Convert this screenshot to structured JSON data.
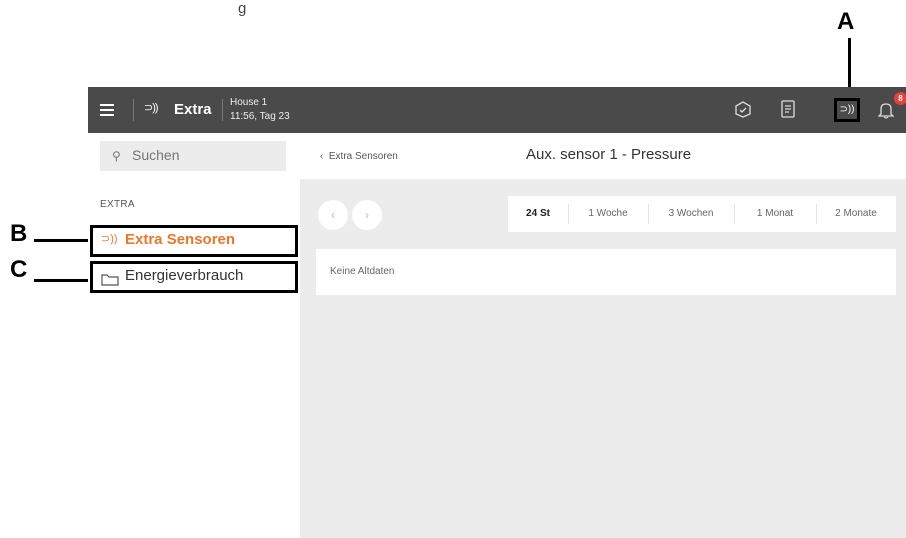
{
  "caption": "g",
  "callouts": {
    "a": "A",
    "b": "B",
    "c": "C"
  },
  "topbar": {
    "mode_icon": "wireless-sensor-icon",
    "title": "Extra",
    "house": "House 1",
    "time": "11:56, Tag 23",
    "notification_count": "8",
    "icons": [
      "menu-icon",
      "box-check-icon",
      "clipboard-icon",
      "wireless-sensor-icon",
      "bell-icon"
    ]
  },
  "sidebar": {
    "search_placeholder": "Suchen",
    "section": "EXTRA",
    "items": [
      {
        "label": "Extra Sensoren",
        "icon": "wireless-sensor-icon",
        "active": true
      },
      {
        "label": "Energieverbrauch",
        "icon": "folder-icon",
        "active": false
      }
    ]
  },
  "main": {
    "back": "Extra Sensoren",
    "title": "Aux. sensor 1 - Pressure",
    "tabs": [
      "24 St",
      "1 Woche",
      "3 Wochen",
      "1 Monat",
      "2 Monate"
    ],
    "active_tab": "24 St",
    "empty_message": "Keine Altdaten"
  },
  "colors": {
    "topbar": "#4a4a4a",
    "accent": "#e8792a",
    "badge": "#e8413a",
    "content_bg": "#ececec"
  }
}
